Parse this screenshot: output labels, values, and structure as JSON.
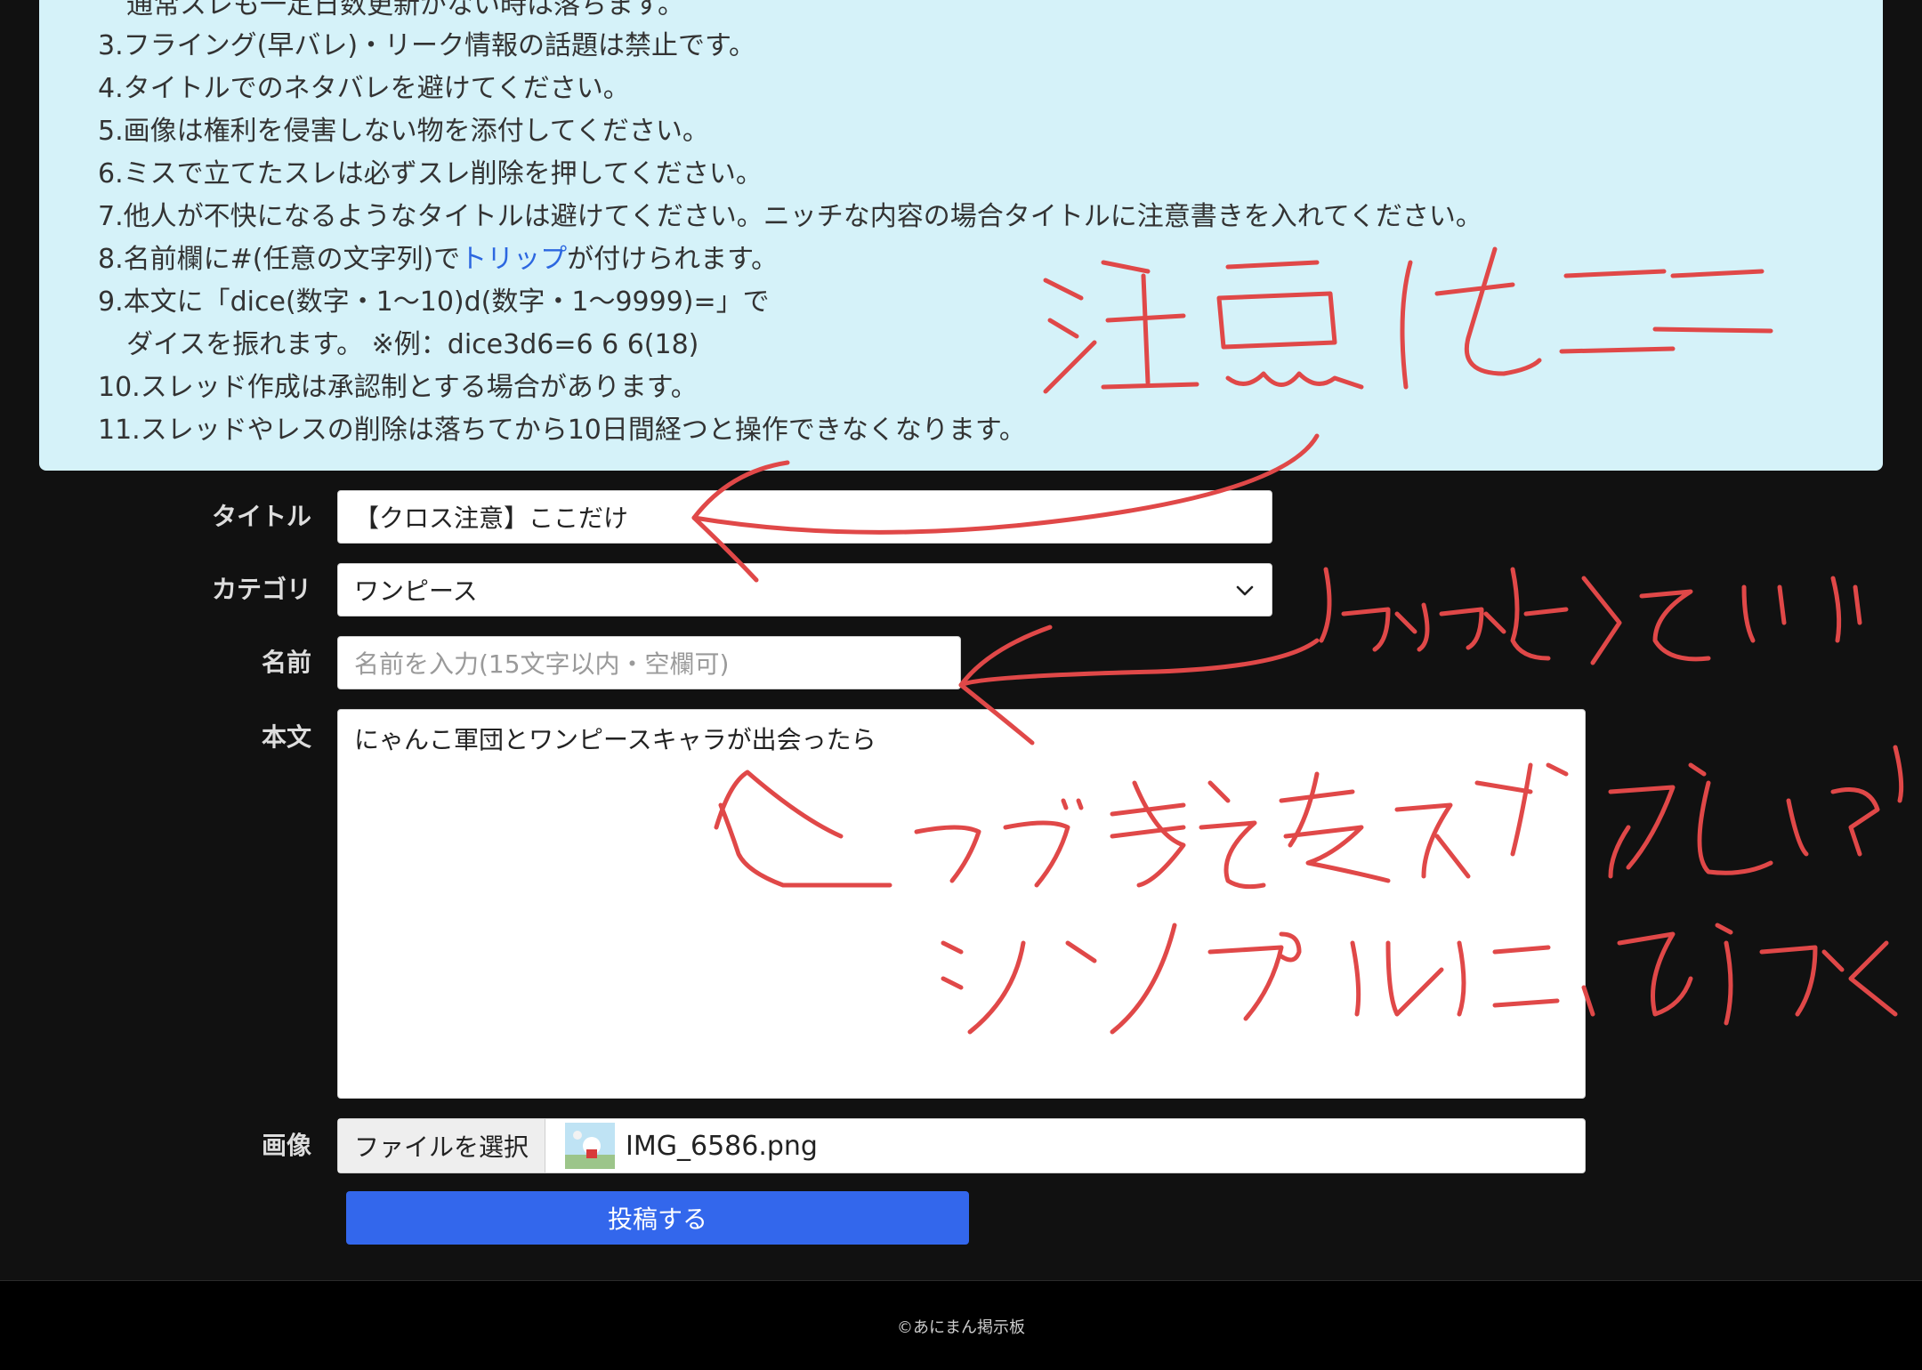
{
  "rules": {
    "line_cut": "通常スレも一定日数更新がない時は落ちます。",
    "line3": "3.フライング(早バレ)・リーク情報の話題は禁止です。",
    "line4": "4.タイトルでのネタバレを避けてください。",
    "line5": "5.画像は権利を侵害しない物を添付してください。",
    "line6": "6.ミスで立てたスレは必ずスレ削除を押してください。",
    "line7": "7.他人が不快になるようなタイトルは避けてください。ニッチな内容の場合タイトルに注意書きを入れてください。",
    "line8_pre": "8.名前欄に#(任意の文字列)で",
    "line8_link": "トリップ",
    "line8_post": "が付けられます。",
    "line9a": "9.本文に「dice(数字・1〜10)d(数字・1〜9999)=」で",
    "line9b": "ダイスを振れます。 ※例：dice3d6=6 6 6(18)",
    "line10": "10.スレッド作成は承認制とする場合があります。",
    "line11": "11.スレッドやレスの削除は落ちてから10日間経つと操作できなくなります。"
  },
  "form": {
    "title_label": "タイトル",
    "title_value": "【クロス注意】ここだけ",
    "category_label": "カテゴリ",
    "category_value": "ワンピース",
    "name_label": "名前",
    "name_placeholder": "名前を入力(15文字以内・空欄可)",
    "body_label": "本文",
    "body_value": "にゃんこ軍団とワンピースキャラが出会ったら",
    "image_label": "画像",
    "file_button": "ファイルを選択",
    "file_name": "IMG_6586.png",
    "submit": "投稿する"
  },
  "footer": {
    "copyright": "©あにまん掲示板"
  },
  "annotations": {
    "note1": "注意はここ",
    "note2": "かかなくていい",
    "note3": "つづきを考えやすいように",
    "note4": "シンプルにみじかく"
  },
  "colors": {
    "background": "#111111",
    "rules_bg": "#d5f2f9",
    "link": "#2c67e0",
    "submit": "#3367ec",
    "annotation_red": "#e04848"
  }
}
